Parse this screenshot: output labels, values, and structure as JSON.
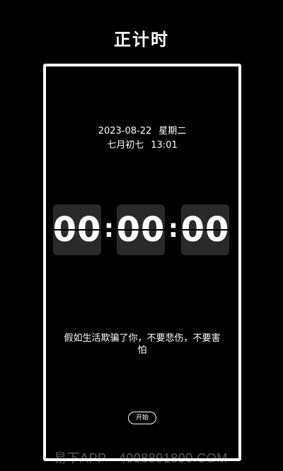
{
  "header": {
    "title": "正计时"
  },
  "info": {
    "date": "2023-08-22",
    "weekday": "星期二",
    "lunar": "七月初七",
    "time": "13:01"
  },
  "timer": {
    "hours": "00",
    "minutes": "00",
    "seconds": "00",
    "separator": ":"
  },
  "quote": "假如生活欺骗了你，不要悲伤，不要害怕",
  "start_button": {
    "label": "开始"
  },
  "watermark": "易下APP · 4008891800.COM"
}
